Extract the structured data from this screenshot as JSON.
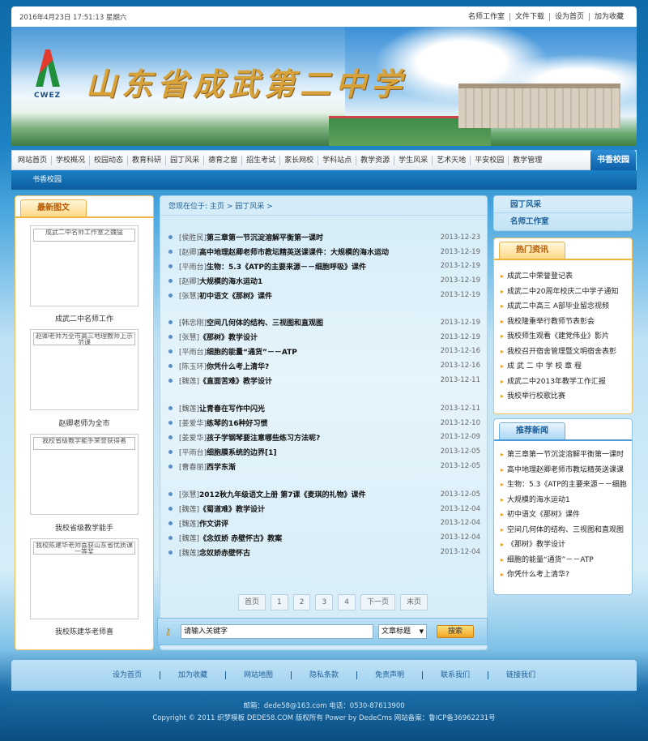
{
  "topbar": {
    "datetime": "2016年4月23日 17:51:13 星期六",
    "links": [
      "名师工作室",
      "文件下载",
      "设为首页",
      "加为收藏"
    ]
  },
  "banner": {
    "logo_text": "CWEZ",
    "school_name": "山东省成武第二中学"
  },
  "nav": {
    "items": [
      "网站首页",
      "学校概况",
      "校园动态",
      "教育科研",
      "园丁风采",
      "德育之窗",
      "招生考试",
      "家长网校",
      "学科站点",
      "教学资源",
      "学生风采",
      "艺术天地",
      "平安校园",
      "教学管理"
    ],
    "active": "书香校园"
  },
  "subnav": {
    "label": "书香校园"
  },
  "left": {
    "tab": "最新图文",
    "pics": [
      {
        "alt": "成武二中名师工作室之魏猛",
        "caption": "成武二中名师工作"
      },
      {
        "alt": "赵卿老师为全市高三地理教师上示范课",
        "caption": "赵卿老师为全市"
      },
      {
        "alt": "我校省级教学能手荣誉获得者",
        "caption": "我校省级教学能手"
      },
      {
        "alt": "我校陈建华老师喜获山东省优质课一等奖",
        "caption": "我校陈建华老师喜"
      }
    ]
  },
  "main": {
    "crumb_prefix": "您现在位于:",
    "crumb_home": "主页",
    "crumb_sep": ">",
    "crumb_current": "园丁风采",
    "groups": [
      [
        {
          "tag": "[侯胜民]",
          "title": "第三章第一节沉淀溶解平衡第一课时",
          "date": "2013-12-23"
        },
        {
          "tag": "[赵卿]",
          "title": "高中地理赵卿老师市教坛精英送课课件：大规模的海水运动",
          "date": "2013-12-19"
        },
        {
          "tag": "[平雨台]",
          "title": "生物：5.3《ATP的主要来源－－细胞呼吸》课件",
          "date": "2013-12-19"
        },
        {
          "tag": "[赵卿]",
          "title": "大规模的海水运动1",
          "date": "2013-12-19"
        },
        {
          "tag": "[张慧]",
          "title": "初中语文《那树》课件",
          "date": "2013-12-19"
        }
      ],
      [
        {
          "tag": "[韩忠刚]",
          "title": "空间几何体的结构、三视图和直观图",
          "date": "2013-12-19"
        },
        {
          "tag": "[张慧]",
          "title": "《那树》教学设计",
          "date": "2013-12-19"
        },
        {
          "tag": "[平雨台]",
          "title": "细胞的能量“通货”－－ATP",
          "date": "2013-12-16"
        },
        {
          "tag": "[陈玉环]",
          "title": "你凭什么考上清华?",
          "date": "2013-12-16"
        },
        {
          "tag": "[魏莲]",
          "title": "《直面苦难》教学设计",
          "date": "2013-12-11"
        }
      ],
      [
        {
          "tag": "[魏莲]",
          "title": "让青春在写作中闪光",
          "date": "2013-12-11"
        },
        {
          "tag": "[姜爱华]",
          "title": "练琴的16种好习惯",
          "date": "2013-12-10"
        },
        {
          "tag": "[姜爱华]",
          "title": "孩子学钢琴要注意哪些练习方法呢?",
          "date": "2013-12-09"
        },
        {
          "tag": "[平雨台]",
          "title": "细胞膜系统的边界[1]",
          "date": "2013-12-05"
        },
        {
          "tag": "[曹春丽]",
          "title": "西学东渐",
          "date": "2013-12-05"
        }
      ],
      [
        {
          "tag": "[张慧]",
          "title": "2012秋九年级语文上册 第7课《麦琪的礼物》课件",
          "date": "2013-12-05"
        },
        {
          "tag": "[魏莲]",
          "title": "《蜀道难》教学设计",
          "date": "2013-12-04"
        },
        {
          "tag": "[魏莲]",
          "title": "作文讲评",
          "date": "2013-12-04"
        },
        {
          "tag": "[魏莲]",
          "title": "《念奴娇 赤壁怀古》教案",
          "date": "2013-12-04"
        },
        {
          "tag": "[魏莲]",
          "title": "念奴娇赤壁怀古",
          "date": "2013-12-04"
        }
      ]
    ],
    "pager": [
      "首页",
      "1",
      "2",
      "3",
      "4",
      "下一页",
      "末页"
    ],
    "search": {
      "placeholder": "请输入关键字",
      "select": "文章标题",
      "button": "搜索"
    }
  },
  "right": {
    "menu": [
      "园丁风采",
      "名师工作室"
    ],
    "hot_tab": "热门资讯",
    "hot": [
      "成武二中荣誉登记表",
      "成武二中20周年校庆二中学子通知",
      "成武二中高三 A部毕业留念视频",
      "我校隆重举行教师节表彰会",
      "我校师生观看《建党伟业》影片",
      "我校召开宿舍管理暨文明宿舍表彰",
      "成 武 二 中 学 校 章 程",
      "成武二中2013年教学工作汇报",
      "我校举行校歌比赛"
    ],
    "rec_tab": "推荐新闻",
    "rec": [
      "第三章第一节沉淀溶解平衡第一课时",
      "高中地理赵卿老师市教坛精英送课课",
      "生物：5.3《ATP的主要来源－－细胞",
      "大规模的海水运动1",
      "初中语文《那树》课件",
      "空间几何体的结构、三视图和直观图",
      "《那树》教学设计",
      "细胞的能量“通货”－－ATP",
      "你凭什么考上清华?"
    ]
  },
  "footer": {
    "links": [
      "设为首页",
      "加为收藏",
      "网站地图",
      "隐私条款",
      "免责声明",
      "联系我们",
      "链接我们"
    ],
    "contact": "邮箱：dede58@163.com 电话：0530-87613900",
    "copyright": "Copyright © 2011 织梦模板 DEDE58.COM 版权所有 Power by DedeCms 网站备案：鲁ICP备36962231号"
  }
}
